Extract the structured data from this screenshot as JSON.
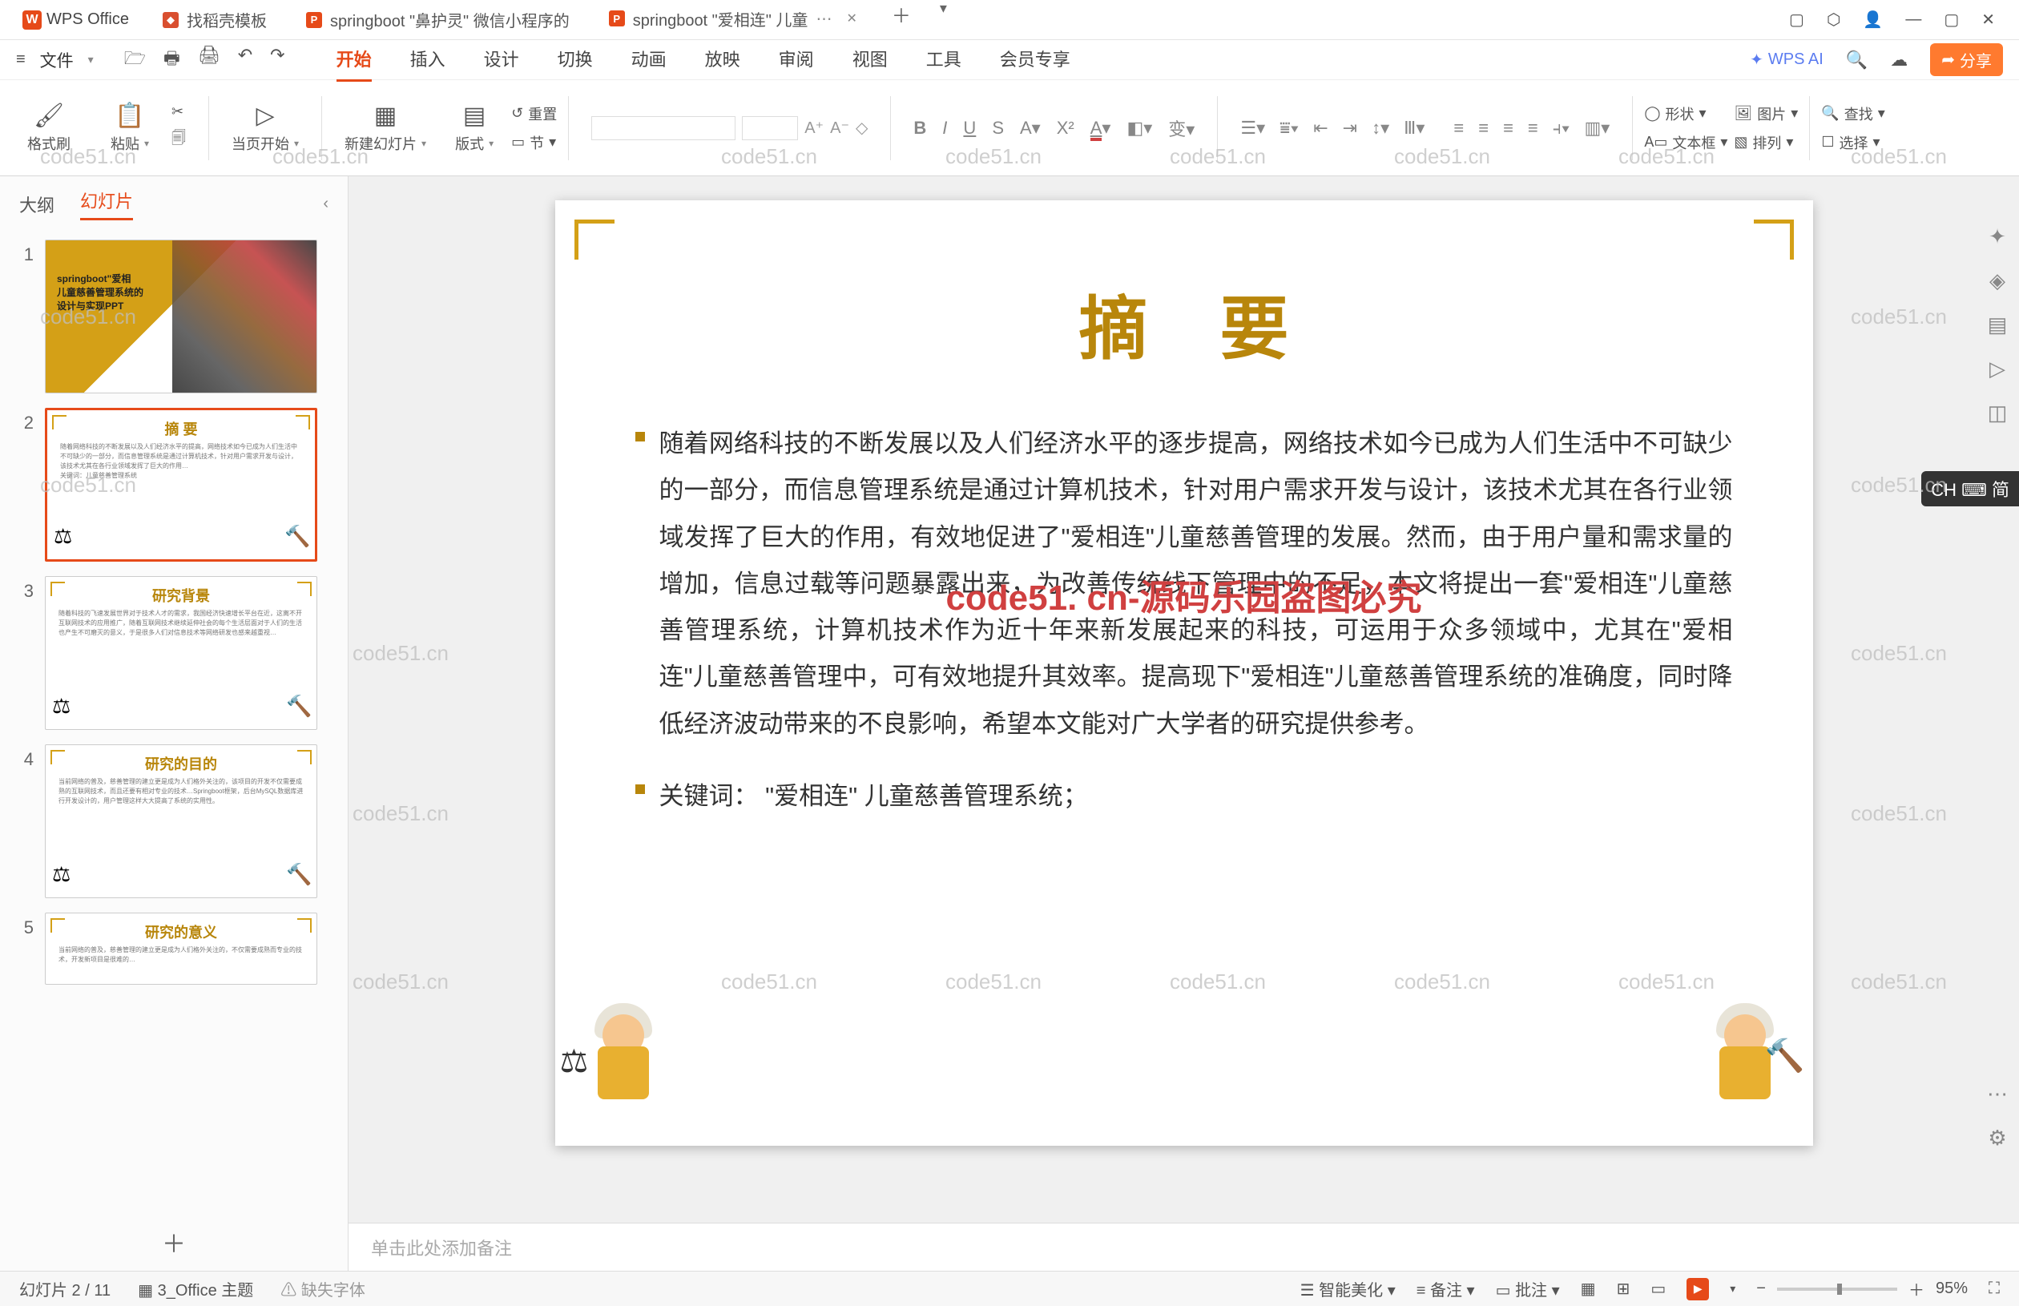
{
  "app_name": "WPS Office",
  "tabs": [
    {
      "label": "找稻壳模板"
    },
    {
      "label": "springboot \"鼻护灵\" 微信小程序的"
    },
    {
      "label": "springboot \"爱相连\" 儿童"
    }
  ],
  "menubar": {
    "file": "文件"
  },
  "menus": {
    "start": "开始",
    "insert": "插入",
    "design": "设计",
    "transition": "切换",
    "animation": "动画",
    "show": "放映",
    "review": "审阅",
    "view": "视图",
    "tools": "工具",
    "member": "会员专享",
    "wpsai": "WPS AI"
  },
  "share_btn": "分享",
  "ribbon": {
    "format_brush": "格式刷",
    "paste": "粘贴",
    "from_current": "当页开始",
    "new_slide": "新建幻灯片",
    "layout": "版式",
    "section": "节",
    "reset": "重置",
    "shape": "形状",
    "picture": "图片",
    "textbox": "文本框",
    "arrange": "排列",
    "find": "查找",
    "select": "选择"
  },
  "left_panel": {
    "outline": "大纲",
    "slides": "幻灯片"
  },
  "thumbs": {
    "t1_l1": "springboot\"爱相",
    "t1_l2": "儿童慈善管理系统的",
    "t1_l3": "设计与实现PPT",
    "t2_title": "摘  要",
    "t3_title": "研究背景",
    "t4_title": "研究的目的",
    "t5_title": "研究的意义"
  },
  "slide": {
    "title": "摘要",
    "para": "随着网络科技的不断发展以及人们经济水平的逐步提高，网络技术如今已成为人们生活中不可缺少的一部分，而信息管理系统是通过计算机技术，针对用户需求开发与设计，该技术尤其在各行业领域发挥了巨大的作用，有效地促进了\"爱相连\"儿童慈善管理的发展。然而，由于用户量和需求量的增加，信息过载等问题暴露出来，为改善传统线下管理中的不足，本文将提出一套\"爱相连\"儿童慈善管理系统，计算机技术作为近十年来新发展起来的科技，可运用于众多领域中，尤其在\"爱相连\"儿童慈善管理中，可有效地提升其效率。提高现下\"爱相连\"儿童慈善管理系统的准确度，同时降低经济波动带来的不良影响，希望本文能对广大学者的研究提供参考。",
    "kw": "关键词：   \"爱相连\" 儿童慈善管理系统；",
    "watermark_center": "code51. cn-源码乐园盗图必究"
  },
  "notes_placeholder": "单击此处添加备注",
  "status": {
    "slide_pos": "幻灯片 2 / 11",
    "theme": "3_Office 主题",
    "missing_font": "缺失字体",
    "smart": "智能美化",
    "notes": "备注",
    "review": "批注",
    "zoom_pct": "95%"
  },
  "watermark": "code51.cn",
  "ime": "CH ⌨ 简"
}
